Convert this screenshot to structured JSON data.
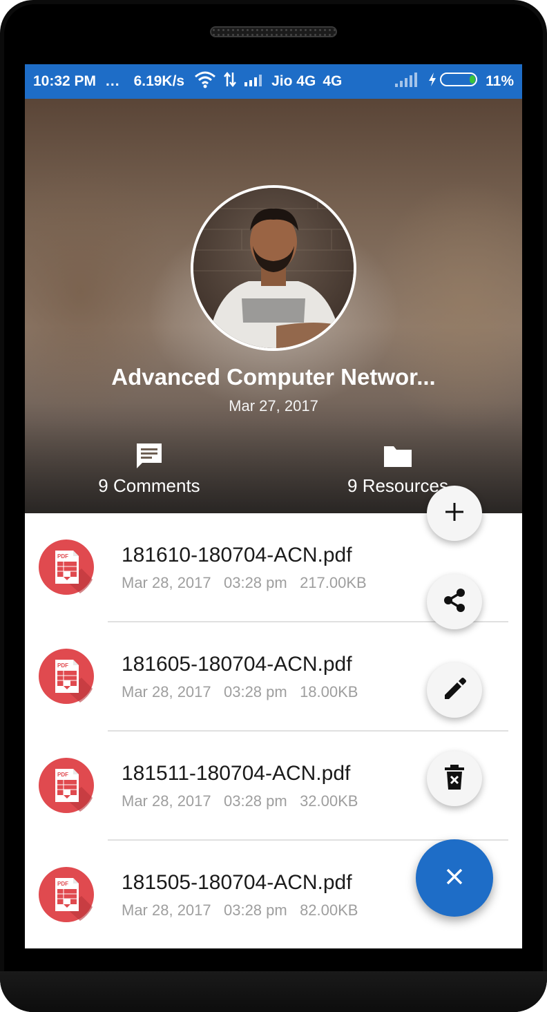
{
  "status_bar": {
    "time": "10:32 PM",
    "dots": "...",
    "speed": "6.19K/s",
    "carrier": "Jio 4G",
    "network_type": "4G",
    "battery": "11%"
  },
  "header": {
    "title": "Advanced Computer Networ...",
    "date": "Mar 27, 2017",
    "comments_label": "9 Comments",
    "resources_label": "9 Resources"
  },
  "files": [
    {
      "name": "181610-180704-ACN.pdf",
      "date": "Mar 28, 2017",
      "time": "03:28 pm",
      "size": "217.00KB"
    },
    {
      "name": "181605-180704-ACN.pdf",
      "date": "Mar 28, 2017",
      "time": "03:28 pm",
      "size": "18.00KB"
    },
    {
      "name": "181511-180704-ACN.pdf",
      "date": "Mar 28, 2017",
      "time": "03:28 pm",
      "size": "32.00KB"
    },
    {
      "name": "181505-180704-ACN.pdf",
      "date": "Mar 28, 2017",
      "time": "03:28 pm",
      "size": "82.00KB"
    }
  ],
  "fab_actions": [
    "plus-icon",
    "share-icon",
    "edit-icon",
    "delete-icon"
  ],
  "fab_main_icon": "close-icon",
  "pdf_icon_label": "PDF",
  "colors": {
    "accent": "#1e6dc7",
    "pdf_red": "#e04a4f",
    "fab_bg": "#f5f5f5"
  }
}
